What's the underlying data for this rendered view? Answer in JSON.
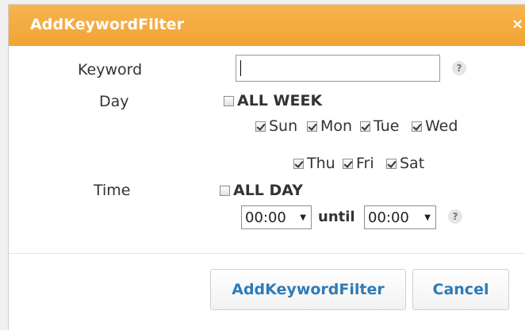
{
  "dialog": {
    "title": "AddKeywordFilter",
    "close_glyph": "×"
  },
  "keyword": {
    "label": "Keyword",
    "value": "",
    "help_glyph": "?"
  },
  "day": {
    "label": "Day",
    "all_week": {
      "label": "ALL WEEK",
      "checked": false
    },
    "days": [
      {
        "label": "Sun",
        "checked": true
      },
      {
        "label": "Mon",
        "checked": true
      },
      {
        "label": "Tue",
        "checked": true
      },
      {
        "label": "Wed",
        "checked": true
      },
      {
        "label": "Thu",
        "checked": true
      },
      {
        "label": "Fri",
        "checked": true
      },
      {
        "label": "Sat",
        "checked": true
      }
    ]
  },
  "time": {
    "label": "Time",
    "all_day": {
      "label": "ALL DAY",
      "checked": false
    },
    "start": "00:00",
    "until_label": "until",
    "end": "00:00",
    "help_glyph": "?",
    "arrow_glyph": "▼"
  },
  "buttons": {
    "submit_label": "AddKeywordFilter",
    "cancel_label": "Cancel"
  },
  "colors": {
    "titlebar": "#f0a334",
    "button_text": "#2e7bb8"
  }
}
